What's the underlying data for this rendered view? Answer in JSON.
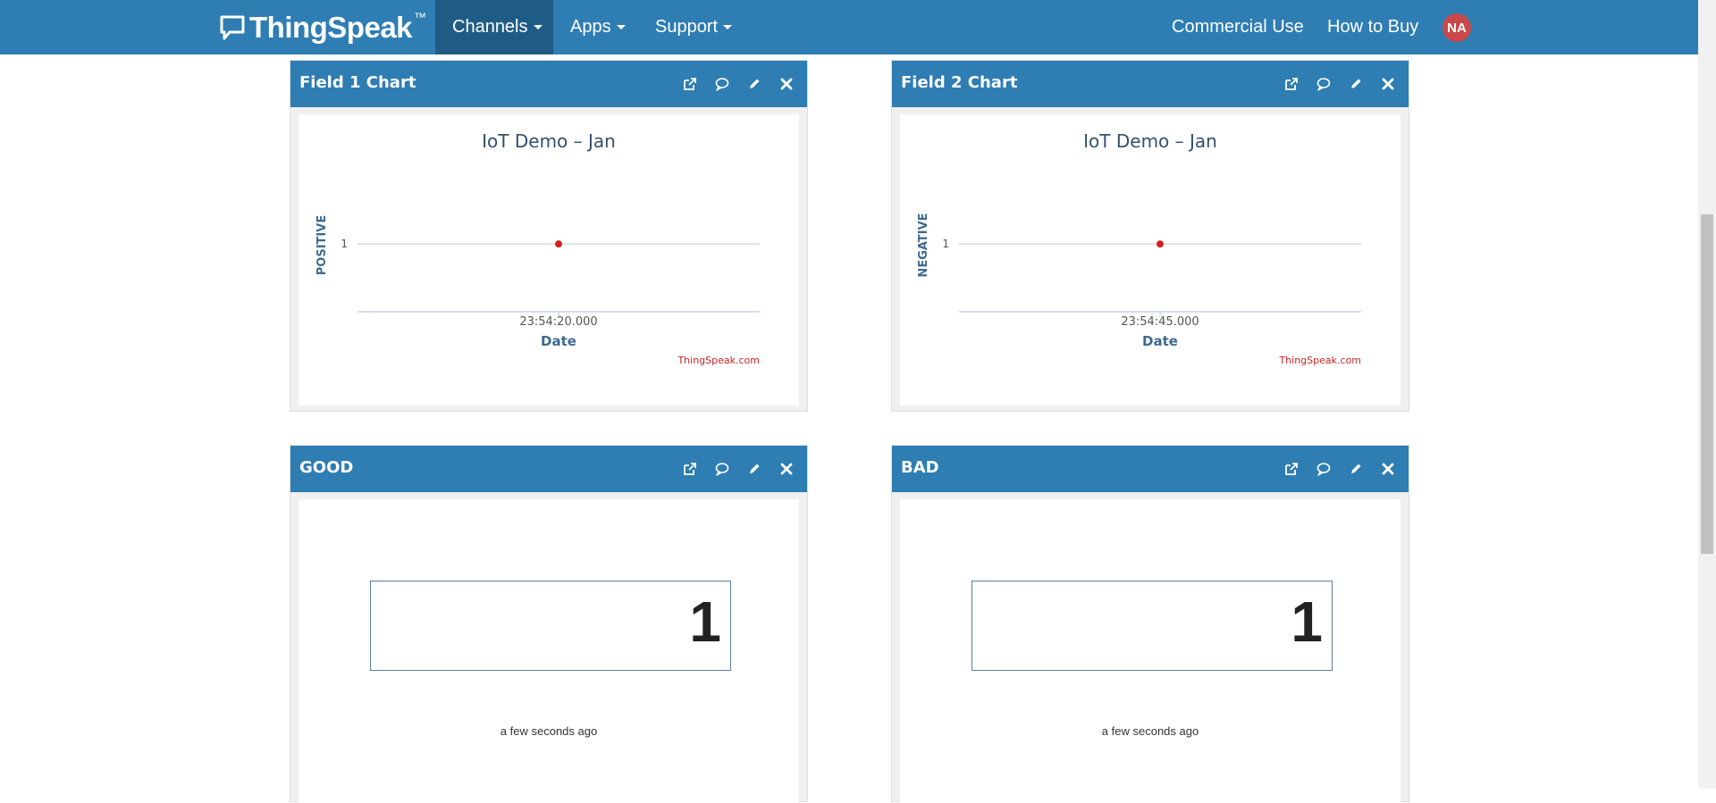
{
  "navbar": {
    "brand": "ThingSpeak",
    "brand_tm": "™",
    "items": [
      {
        "label": "Channels"
      },
      {
        "label": "Apps"
      },
      {
        "label": "Support"
      }
    ],
    "right_links": [
      {
        "label": "Commercial Use"
      },
      {
        "label": "How to Buy"
      }
    ],
    "avatar": "NA"
  },
  "widgets": [
    {
      "title": "Field 1 Chart",
      "chart": {
        "title": "IoT Demo – Jan",
        "ylabel": "POSITIVE",
        "xlabel": "Date",
        "ytick": "1",
        "xtick": "23:54:20.000",
        "credit": "ThingSpeak.com"
      }
    },
    {
      "title": "Field 2 Chart",
      "chart": {
        "title": "IoT Demo – Jan",
        "ylabel": "NEGATIVE",
        "xlabel": "Date",
        "ytick": "1",
        "xtick": "23:54:45.000",
        "credit": "ThingSpeak.com"
      }
    },
    {
      "title": "GOOD",
      "numeric": {
        "value": "1",
        "time": "a few seconds ago"
      }
    },
    {
      "title": "BAD",
      "numeric": {
        "value": "1",
        "time": "a few seconds ago"
      }
    }
  ],
  "chart_data": [
    {
      "type": "scatter",
      "title": "IoT Demo – Jan",
      "xlabel": "Date",
      "ylabel": "POSITIVE",
      "x": [
        "23:54:20.000"
      ],
      "y": [
        1
      ],
      "color": "#d62020",
      "grid": true
    },
    {
      "type": "scatter",
      "title": "IoT Demo – Jan",
      "xlabel": "Date",
      "ylabel": "NEGATIVE",
      "x": [
        "23:54:45.000"
      ],
      "y": [
        1
      ],
      "color": "#d62020",
      "grid": true
    }
  ],
  "colors": {
    "primary": "#2e7db3",
    "active": "#1f5c85",
    "point": "#d62020",
    "avatar": "#c9484a"
  },
  "icons": [
    "external-link-icon",
    "comment-icon",
    "pencil-icon",
    "close-icon"
  ]
}
